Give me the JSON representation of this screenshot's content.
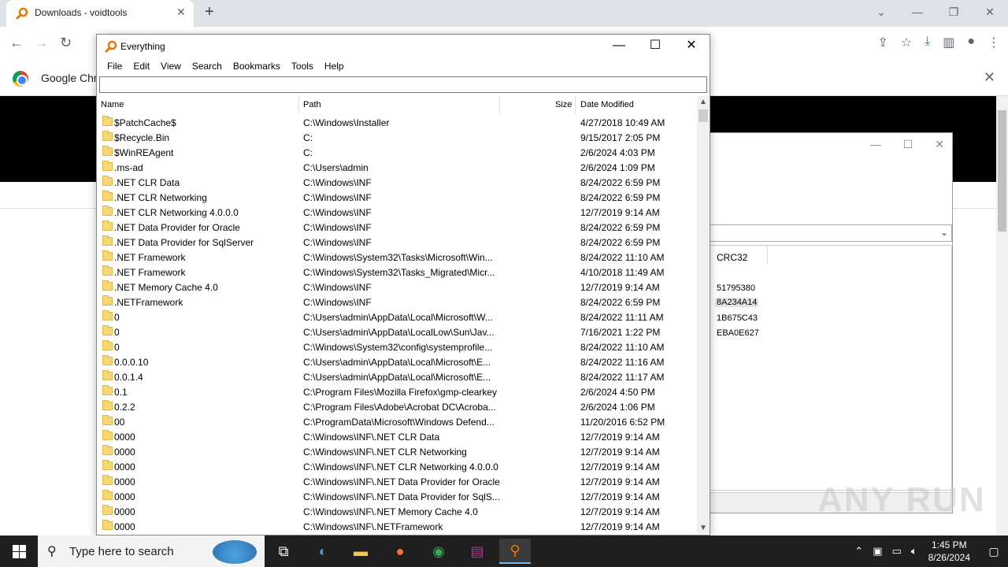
{
  "chrome": {
    "tab_title": "Downloads - voidtools",
    "tab_close": "✕",
    "new_tab": "+",
    "infobar_text": "Google Chro",
    "infobar_close": "✕"
  },
  "bg_window": {
    "column_header": "CRC32",
    "crc_values": [
      "51795380",
      "8A234A14",
      "1B675C43",
      "EBA0E627"
    ]
  },
  "watermark": "ANY RUN",
  "everything": {
    "title": "Everything",
    "menu": [
      "File",
      "Edit",
      "View",
      "Search",
      "Bookmarks",
      "Tools",
      "Help"
    ],
    "search_value": "",
    "columns": {
      "name": "Name",
      "path": "Path",
      "size": "Size",
      "date": "Date Modified"
    },
    "rows": [
      {
        "name": "$PatchCache$",
        "path": "C:\\Windows\\Installer",
        "date": "4/27/2018 10:49 AM"
      },
      {
        "name": "$Recycle.Bin",
        "path": "C:",
        "date": "9/15/2017 2:05 PM"
      },
      {
        "name": "$WinREAgent",
        "path": "C:",
        "date": "2/6/2024 4:03 PM"
      },
      {
        "name": ".ms-ad",
        "path": "C:\\Users\\admin",
        "date": "2/6/2024 1:09 PM"
      },
      {
        "name": ".NET CLR Data",
        "path": "C:\\Windows\\INF",
        "date": "8/24/2022 6:59 PM"
      },
      {
        "name": ".NET CLR Networking",
        "path": "C:\\Windows\\INF",
        "date": "8/24/2022 6:59 PM"
      },
      {
        "name": ".NET CLR Networking 4.0.0.0",
        "path": "C:\\Windows\\INF",
        "date": "12/7/2019 9:14 AM"
      },
      {
        "name": ".NET Data Provider for Oracle",
        "path": "C:\\Windows\\INF",
        "date": "8/24/2022 6:59 PM"
      },
      {
        "name": ".NET Data Provider for SqlServer",
        "path": "C:\\Windows\\INF",
        "date": "8/24/2022 6:59 PM"
      },
      {
        "name": ".NET Framework",
        "path": "C:\\Windows\\System32\\Tasks\\Microsoft\\Win...",
        "date": "8/24/2022 11:10 AM"
      },
      {
        "name": ".NET Framework",
        "path": "C:\\Windows\\System32\\Tasks_Migrated\\Micr...",
        "date": "4/10/2018 11:49 AM"
      },
      {
        "name": ".NET Memory Cache 4.0",
        "path": "C:\\Windows\\INF",
        "date": "12/7/2019 9:14 AM"
      },
      {
        "name": ".NETFramework",
        "path": "C:\\Windows\\INF",
        "date": "8/24/2022 6:59 PM"
      },
      {
        "name": "0",
        "path": "C:\\Users\\admin\\AppData\\Local\\Microsoft\\W...",
        "date": "8/24/2022 11:11 AM"
      },
      {
        "name": "0",
        "path": "C:\\Users\\admin\\AppData\\LocalLow\\Sun\\Jav...",
        "date": "7/16/2021 1:22 PM"
      },
      {
        "name": "0",
        "path": "C:\\Windows\\System32\\config\\systemprofile...",
        "date": "8/24/2022 11:10 AM"
      },
      {
        "name": "0.0.0.10",
        "path": "C:\\Users\\admin\\AppData\\Local\\Microsoft\\E...",
        "date": "8/24/2022 11:16 AM"
      },
      {
        "name": "0.0.1.4",
        "path": "C:\\Users\\admin\\AppData\\Local\\Microsoft\\E...",
        "date": "8/24/2022 11:17 AM"
      },
      {
        "name": "0.1",
        "path": "C:\\Program Files\\Mozilla Firefox\\gmp-clearkey",
        "date": "2/6/2024 4:50 PM"
      },
      {
        "name": "0.2.2",
        "path": "C:\\Program Files\\Adobe\\Acrobat DC\\Acroba...",
        "date": "2/6/2024 1:06 PM"
      },
      {
        "name": "00",
        "path": "C:\\ProgramData\\Microsoft\\Windows Defend...",
        "date": "11/20/2016 6:52 PM"
      },
      {
        "name": "0000",
        "path": "C:\\Windows\\INF\\.NET CLR Data",
        "date": "12/7/2019 9:14 AM"
      },
      {
        "name": "0000",
        "path": "C:\\Windows\\INF\\.NET CLR Networking",
        "date": "12/7/2019 9:14 AM"
      },
      {
        "name": "0000",
        "path": "C:\\Windows\\INF\\.NET CLR Networking 4.0.0.0",
        "date": "12/7/2019 9:14 AM"
      },
      {
        "name": "0000",
        "path": "C:\\Windows\\INF\\.NET Data Provider for Oracle",
        "date": "12/7/2019 9:14 AM"
      },
      {
        "name": "0000",
        "path": "C:\\Windows\\INF\\.NET Data Provider for SqlS...",
        "date": "12/7/2019 9:14 AM"
      },
      {
        "name": "0000",
        "path": "C:\\Windows\\INF\\.NET Memory Cache 4.0",
        "date": "12/7/2019 9:14 AM"
      },
      {
        "name": "0000",
        "path": "C:\\Windows\\INF\\.NETFramework",
        "date": "12/7/2019 9:14 AM"
      }
    ]
  },
  "taskbar": {
    "search_placeholder": "Type here to search",
    "time": "1:45 PM",
    "date": "8/26/2024"
  }
}
